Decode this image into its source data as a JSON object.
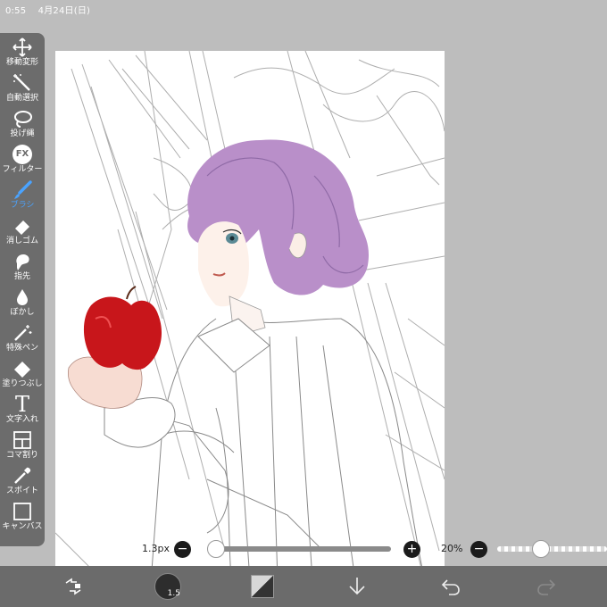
{
  "status": {
    "time": "0:55",
    "date": "4月24日(日)"
  },
  "tools": [
    {
      "id": "move",
      "label": "移動変形",
      "icon": "move-transform-icon",
      "active": false
    },
    {
      "id": "magic",
      "label": "自動選択",
      "icon": "magic-wand-icon",
      "active": false
    },
    {
      "id": "lasso",
      "label": "投げ縄",
      "icon": "lasso-icon",
      "active": false
    },
    {
      "id": "filter",
      "label": "フィルター",
      "icon": "fx-icon",
      "glyph": "FX",
      "active": false
    },
    {
      "id": "brush",
      "label": "ブラシ",
      "icon": "brush-icon",
      "active": true
    },
    {
      "id": "eraser",
      "label": "消しゴム",
      "icon": "eraser-icon",
      "active": false
    },
    {
      "id": "finger",
      "label": "指先",
      "icon": "finger-icon",
      "active": false
    },
    {
      "id": "blur",
      "label": "ぼかし",
      "icon": "blur-drop-icon",
      "active": false
    },
    {
      "id": "special",
      "label": "特殊ペン",
      "icon": "special-pen-icon",
      "active": false
    },
    {
      "id": "fill",
      "label": "塗りつぶし",
      "icon": "fill-bucket-icon",
      "active": false
    },
    {
      "id": "text",
      "label": "文字入れ",
      "icon": "text-icon",
      "glyph": "T",
      "active": false
    },
    {
      "id": "frame",
      "label": "コマ割り",
      "icon": "frame-divider-icon",
      "active": false
    },
    {
      "id": "dropper",
      "label": "スポイト",
      "icon": "eyedropper-icon",
      "active": false
    },
    {
      "id": "canvas",
      "label": "キャンバス",
      "icon": "canvas-icon",
      "active": false
    }
  ],
  "brush_size": {
    "value": "1.3px",
    "level": 0.05,
    "minus": "−",
    "plus": "+"
  },
  "opacity": {
    "value": "20%",
    "level": 0.4,
    "minus": "−"
  },
  "bottom_bar": {
    "brush_badge": "1.5",
    "icons": [
      "swap-transform-icon",
      "brush-preview-icon",
      "color-swatch-icon",
      "down-arrow-icon",
      "undo-icon",
      "redo-icon"
    ]
  },
  "colors": {
    "accent": "#4aa3ff",
    "toolbar": "#6c6c6c",
    "bottom_bar": "#6b6b6b",
    "background": "#bdbdbd",
    "hair": "#b98fc9",
    "apple": "#c8161b"
  }
}
